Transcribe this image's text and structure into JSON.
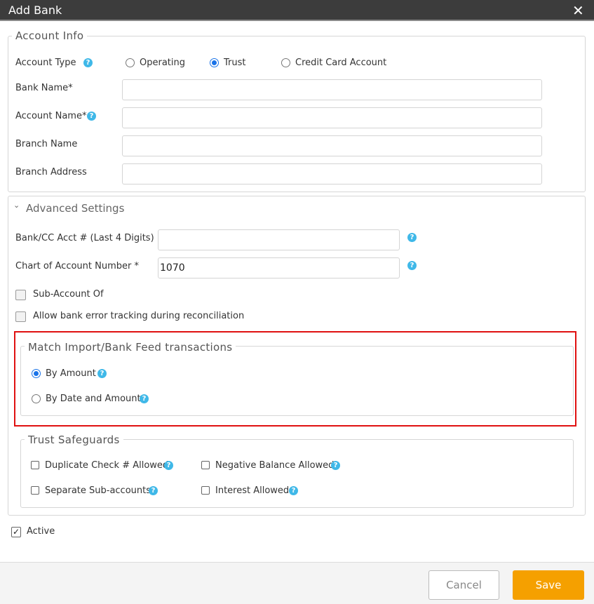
{
  "dialog": {
    "title": "Add Bank",
    "close_icon": "close-icon"
  },
  "account_info": {
    "legend": "Account Info",
    "account_type_label": "Account Type",
    "account_types": [
      {
        "label": "Operating",
        "selected": false
      },
      {
        "label": "Trust",
        "selected": true
      },
      {
        "label": "Credit Card Account",
        "selected": false
      }
    ],
    "fields": [
      {
        "label": "Bank Name*",
        "value": ""
      },
      {
        "label": "Account Name*",
        "value": "",
        "help": true
      },
      {
        "label": "Branch Name",
        "value": ""
      },
      {
        "label": "Branch Address",
        "value": ""
      }
    ]
  },
  "advanced": {
    "header": "Advanced Settings",
    "acct_digits_label": "Bank/CC Acct # (Last 4 Digits)",
    "acct_digits_value": "",
    "coa_label": "Chart of Account Number *",
    "coa_value": "1070",
    "sub_account_label": "Sub-Account Of",
    "sub_account_checked": false,
    "bank_error_label": "Allow bank error tracking during reconciliation",
    "bank_error_checked": false
  },
  "match": {
    "legend": "Match Import/Bank Feed transactions",
    "options": [
      {
        "label": "By Amount",
        "selected": true
      },
      {
        "label": "By Date and Amount",
        "selected": false
      }
    ]
  },
  "safeguards": {
    "legend": "Trust Safeguards",
    "items": [
      {
        "label": "Duplicate Check # Allowed",
        "checked": false
      },
      {
        "label": "Negative Balance Allowed",
        "checked": false
      },
      {
        "label": "Separate Sub-accounts",
        "checked": false
      },
      {
        "label": "Interest Allowed",
        "checked": false
      }
    ]
  },
  "active": {
    "label": "Active",
    "checked": true
  },
  "footer": {
    "cancel": "Cancel",
    "save": "Save"
  },
  "colors": {
    "accent": "#f5a000",
    "highlight": "#e01010",
    "help": "#3fb8e8",
    "radio": "#1a73e8"
  }
}
